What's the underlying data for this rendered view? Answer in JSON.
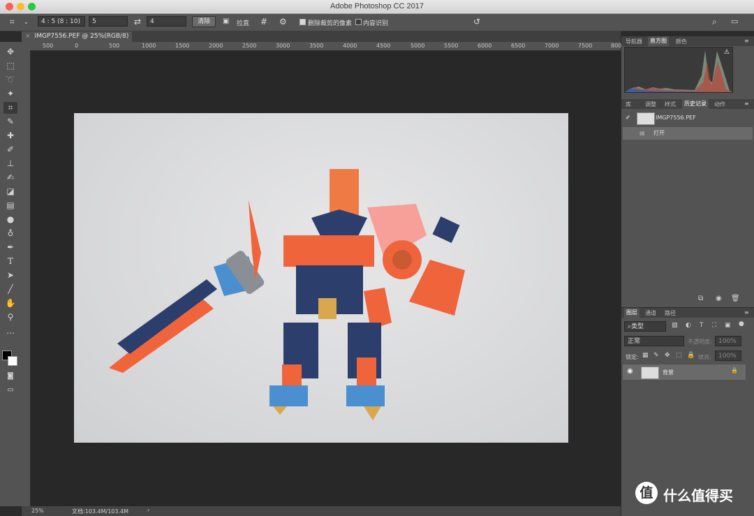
{
  "window": {
    "title": "Adobe Photoshop CC 2017"
  },
  "options_bar": {
    "ratio_select": "4 : 5 (8 : 10)",
    "ratio_w": "5",
    "ratio_h": "4",
    "clear_button": "清除",
    "straighten_label": "拉直",
    "delete_cropped_label": "删除裁剪的像素",
    "delete_cropped_checked": true,
    "content_aware_label": "内容识别",
    "content_aware_checked": false
  },
  "document_tab": {
    "title": "IMGP7556.PEF @ 25%(RGB/8)"
  },
  "ruler_top_labels": [
    "500",
    "0",
    "500",
    "1000",
    "1500",
    "2000",
    "2500",
    "3000",
    "3500",
    "4000",
    "4500",
    "5000",
    "5500",
    "6000",
    "6500",
    "7000",
    "7500",
    "8000"
  ],
  "status_bar": {
    "zoom": "25%",
    "doc_info": "文档:103.4M/103.4M"
  },
  "panel_top": {
    "tabs": [
      "导航器",
      "直方图",
      "颜色"
    ],
    "selected": "直方图"
  },
  "panel_mid": {
    "tabs": [
      "库",
      "调整",
      "样式",
      "历史记录",
      "动作"
    ],
    "selected": "历史记录",
    "snapshot_name": "IMGP7556.PEF",
    "history_items": [
      {
        "label": "打开"
      }
    ]
  },
  "panel_layers": {
    "tabs": [
      "图层",
      "通道",
      "路径"
    ],
    "selected": "图层",
    "filter_kind": "类型",
    "blend_mode": "正常",
    "opacity_label": "不透明度:",
    "opacity_value": "100%",
    "lock_label": "锁定:",
    "fill_label": "填充:",
    "fill_value": "100%",
    "layer_name": "背景"
  },
  "watermark": {
    "logo_char": "值",
    "text": "什么值得买"
  },
  "colors": {
    "accent_orange": "#f0643c",
    "robot_blue": "#2c3e6b",
    "sky_blue": "#4a8fd0",
    "gold": "#d9a84e"
  }
}
